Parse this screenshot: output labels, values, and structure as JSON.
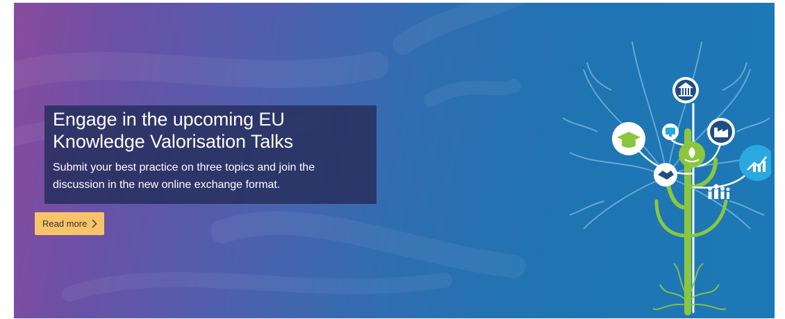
{
  "banner": {
    "title": "Engage in the upcoming EU Knowledge Valorisation Talks",
    "description": "Submit your best practice on three topics and join the discussion in the new online exchange format.",
    "button_label": "Read more",
    "button_icon": "chevron-right-icon",
    "accent_colors": {
      "gradient_start": "#8a4a9e",
      "gradient_end": "#1d79b6",
      "button": "#f9c36a",
      "card": "#283060",
      "tree_green": "#8cc63f"
    }
  },
  "illustration": {
    "icons": [
      "government-building-icon",
      "graduation-cap-icon",
      "computer-icon",
      "factory-icon",
      "plant-in-hand-icon",
      "handshake-icon",
      "euro-growth-chart-icon",
      "people-group-icon"
    ]
  }
}
